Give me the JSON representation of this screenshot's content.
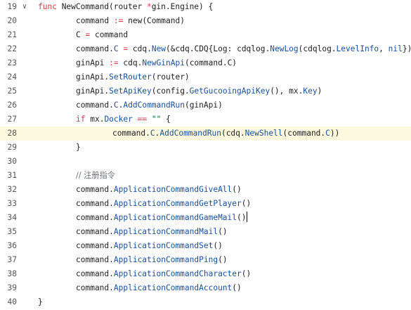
{
  "editor": {
    "fold_glyph": "∨",
    "lines": [
      {
        "n": "19",
        "fold": true,
        "indent": 0,
        "tokens": [
          {
            "t": "func",
            "c": "kw"
          },
          {
            "t": " NewCommand(router "
          },
          {
            "t": "*",
            "c": "op"
          },
          {
            "t": "gin.Engine) {"
          }
        ]
      },
      {
        "n": "20",
        "indent": 1,
        "tokens": [
          {
            "t": "command "
          },
          {
            "t": ":=",
            "c": "op"
          },
          {
            "t": " new(Command)"
          }
        ]
      },
      {
        "n": "21",
        "indent": 1,
        "tokens": [
          {
            "t": "C "
          },
          {
            "t": "=",
            "c": "op"
          },
          {
            "t": " command"
          }
        ]
      },
      {
        "n": "22",
        "indent": 1,
        "tokens": [
          {
            "t": "command."
          },
          {
            "t": "C",
            "c": "prop"
          },
          {
            "t": " "
          },
          {
            "t": "=",
            "c": "op"
          },
          {
            "t": " cdq."
          },
          {
            "t": "New",
            "c": "fn"
          },
          {
            "t": "(&cdq.CDQ{Log: cdqlog."
          },
          {
            "t": "NewLog",
            "c": "fn"
          },
          {
            "t": "(cdqlog."
          },
          {
            "t": "LevelInfo",
            "c": "prop"
          },
          {
            "t": ", "
          },
          {
            "t": "nil",
            "c": "nil"
          },
          {
            "t": "})"
          }
        ]
      },
      {
        "n": "23",
        "indent": 1,
        "tokens": [
          {
            "t": "ginApi "
          },
          {
            "t": ":=",
            "c": "op"
          },
          {
            "t": " cdq."
          },
          {
            "t": "NewGinApi",
            "c": "fn"
          },
          {
            "t": "(command.C)"
          }
        ]
      },
      {
        "n": "24",
        "indent": 1,
        "tokens": [
          {
            "t": "ginApi."
          },
          {
            "t": "SetRouter",
            "c": "fn"
          },
          {
            "t": "(router)"
          }
        ]
      },
      {
        "n": "25",
        "indent": 1,
        "tokens": [
          {
            "t": "ginApi."
          },
          {
            "t": "SetApiKey",
            "c": "fn"
          },
          {
            "t": "(config."
          },
          {
            "t": "GetGucooingApiKey",
            "c": "fn"
          },
          {
            "t": "(), mx."
          },
          {
            "t": "Key",
            "c": "prop"
          },
          {
            "t": ")"
          }
        ]
      },
      {
        "n": "26",
        "indent": 1,
        "tokens": [
          {
            "t": "command."
          },
          {
            "t": "C",
            "c": "prop"
          },
          {
            "t": "."
          },
          {
            "t": "AddCommandRun",
            "c": "fn"
          },
          {
            "t": "(ginApi)"
          }
        ]
      },
      {
        "n": "27",
        "indent": 1,
        "tokens": [
          {
            "t": "if",
            "c": "kw"
          },
          {
            "t": " mx."
          },
          {
            "t": "Docker",
            "c": "prop"
          },
          {
            "t": " "
          },
          {
            "t": "==",
            "c": "op"
          },
          {
            "t": " "
          },
          {
            "t": "\"\"",
            "c": "str"
          },
          {
            "t": " {"
          }
        ]
      },
      {
        "n": "28",
        "indent": 2,
        "highlight": true,
        "tokens": [
          {
            "t": "command."
          },
          {
            "t": "C",
            "c": "prop"
          },
          {
            "t": "."
          },
          {
            "t": "AddCommandRun",
            "c": "fn"
          },
          {
            "t": "(cdq."
          },
          {
            "t": "NewShell",
            "c": "fn"
          },
          {
            "t": "(command."
          },
          {
            "t": "C",
            "c": "prop"
          },
          {
            "t": "))"
          }
        ]
      },
      {
        "n": "29",
        "indent": 1,
        "tokens": [
          {
            "t": "}"
          }
        ]
      },
      {
        "n": "30",
        "indent": 0,
        "tokens": []
      },
      {
        "n": "31",
        "indent": 1,
        "tokens": [
          {
            "t": "// 注册指令",
            "c": "cm"
          }
        ]
      },
      {
        "n": "32",
        "indent": 1,
        "tokens": [
          {
            "t": "command."
          },
          {
            "t": "ApplicationCommandGiveAll",
            "c": "fn"
          },
          {
            "t": "()"
          }
        ]
      },
      {
        "n": "33",
        "indent": 1,
        "tokens": [
          {
            "t": "command."
          },
          {
            "t": "ApplicationCommandGetPlayer",
            "c": "fn"
          },
          {
            "t": "()"
          }
        ]
      },
      {
        "n": "34",
        "indent": 1,
        "caret": true,
        "tokens": [
          {
            "t": "command."
          },
          {
            "t": "ApplicationCommandGameMail",
            "c": "fn"
          },
          {
            "t": "()"
          }
        ]
      },
      {
        "n": "35",
        "indent": 1,
        "tokens": [
          {
            "t": "command."
          },
          {
            "t": "ApplicationCommandMail",
            "c": "fn"
          },
          {
            "t": "()"
          }
        ]
      },
      {
        "n": "36",
        "indent": 1,
        "tokens": [
          {
            "t": "command."
          },
          {
            "t": "ApplicationCommandSet",
            "c": "fn"
          },
          {
            "t": "()"
          }
        ]
      },
      {
        "n": "37",
        "indent": 1,
        "tokens": [
          {
            "t": "command."
          },
          {
            "t": "ApplicationCommandPing",
            "c": "fn"
          },
          {
            "t": "()"
          }
        ]
      },
      {
        "n": "38",
        "indent": 1,
        "tokens": [
          {
            "t": "command."
          },
          {
            "t": "ApplicationCommandCharacter",
            "c": "fn"
          },
          {
            "t": "()"
          }
        ]
      },
      {
        "n": "39",
        "indent": 1,
        "tokens": [
          {
            "t": "command."
          },
          {
            "t": "ApplicationCommandAccount",
            "c": "fn"
          },
          {
            "t": "()"
          }
        ]
      },
      {
        "n": "40",
        "indent": 0,
        "tokens": [
          {
            "t": "}"
          }
        ]
      }
    ]
  }
}
